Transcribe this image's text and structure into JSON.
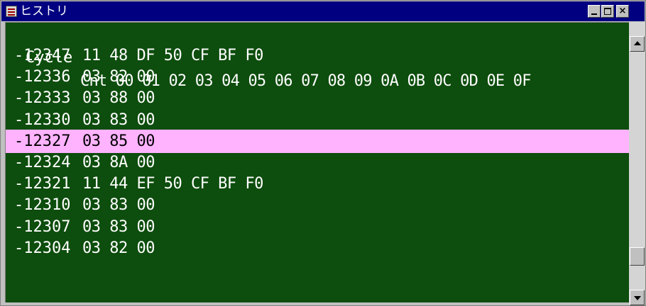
{
  "window": {
    "title": "ヒストリ",
    "minimize_label": "",
    "maximize_label": "",
    "close_label": "×"
  },
  "header": {
    "cycle_label": "Cycle",
    "columns": "Cnt 00 01 02 03 04 05 06 07 08 09 0A 0B 0C 0D 0E 0F"
  },
  "rows": [
    {
      "cycle": "-12347",
      "data": "11 48 DF 50 CF BF F0"
    },
    {
      "cycle": "-12336",
      "data": "03 82 00"
    },
    {
      "cycle": "-12333",
      "data": "03 88 00"
    },
    {
      "cycle": "-12330",
      "data": "03 83 00"
    },
    {
      "cycle": "-12327",
      "data": "03 85 00"
    },
    {
      "cycle": "-12324",
      "data": "03 8A 00"
    },
    {
      "cycle": "-12321",
      "data": "11 44 EF 50 CF BF F0"
    },
    {
      "cycle": "-12310",
      "data": "03 83 00"
    },
    {
      "cycle": "-12307",
      "data": "03 83 00"
    },
    {
      "cycle": "-12304",
      "data": "03 82 00"
    }
  ],
  "selected_row_index": 4,
  "colors": {
    "title_bar": "#000080",
    "background": "#0d4d0d",
    "text": "#ffffff",
    "selection": "#ffb3ff",
    "selection_text": "#000000"
  }
}
